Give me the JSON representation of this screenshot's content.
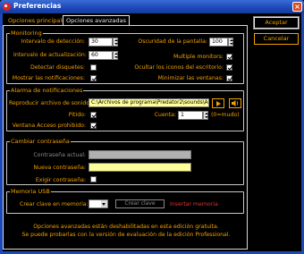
{
  "window": {
    "title": "Preferencias"
  },
  "tabs": {
    "basic": "Opciones principales",
    "advanced": "Opciones avanzadas"
  },
  "buttons": {
    "accept": "Aceptar",
    "cancel": "Cancelar"
  },
  "monitoring": {
    "title": "Monitoring",
    "detection_interval_label": "Intervalo de detección:",
    "detection_interval_value": "30",
    "update_interval_label": "Intervalo de actualización:",
    "update_interval_value": "60",
    "detect_disks_label": "Detectar disquetes:",
    "detect_disks_checked": false,
    "show_notifications_label": "Mostrar las notificaciones:",
    "show_notifications_checked": true,
    "screen_dim_label": "Oscuridad de la pantalla:",
    "screen_dim_value": "100",
    "multiple_monitors_label": "Multiple monitors:",
    "multiple_monitors_checked": true,
    "hide_desktop_icons_label": "Ocultar los iconos del escritorio:",
    "hide_desktop_icons_checked": true,
    "minimize_windows_label": "Minimizar las ventanas:",
    "minimize_windows_checked": true
  },
  "alarm": {
    "title": "Alarma de notificaciones",
    "play_sound_label": "Reproducir archivo de sonido:",
    "sound_path": "C:\\Archivos de programa\\Predator2\\sounds\\ALAR",
    "beep_label": "Pitido:",
    "beep_checked": true,
    "account_label": "Cuenta:",
    "account_value": "1",
    "account_hint": "(0=mudo)",
    "window_label": "Ventana Acceso prohibido:",
    "window_checked": true
  },
  "password": {
    "title": "Cambiar contraseña",
    "current_label": "Contraseña actual:",
    "new_label": "Nueva contraseña:",
    "require_label": "Exigir contraseña:",
    "require_checked": false
  },
  "usb": {
    "title": "Memoria USB",
    "create_key_label": "Crear clave en memoria:",
    "create_button": "Crear clave",
    "status_text": "Insertar memoria"
  },
  "footer": {
    "line1": "Opciones avanzadas están deshabilitadas en esta edición gratuita.",
    "line2": "Se puede probarlas con la versión de evaluación de la edición Professional."
  },
  "colors": {
    "accent": "#f0a000",
    "titlebar": "#1c48b8",
    "field": "#ffff99",
    "warning": "#e03030"
  }
}
